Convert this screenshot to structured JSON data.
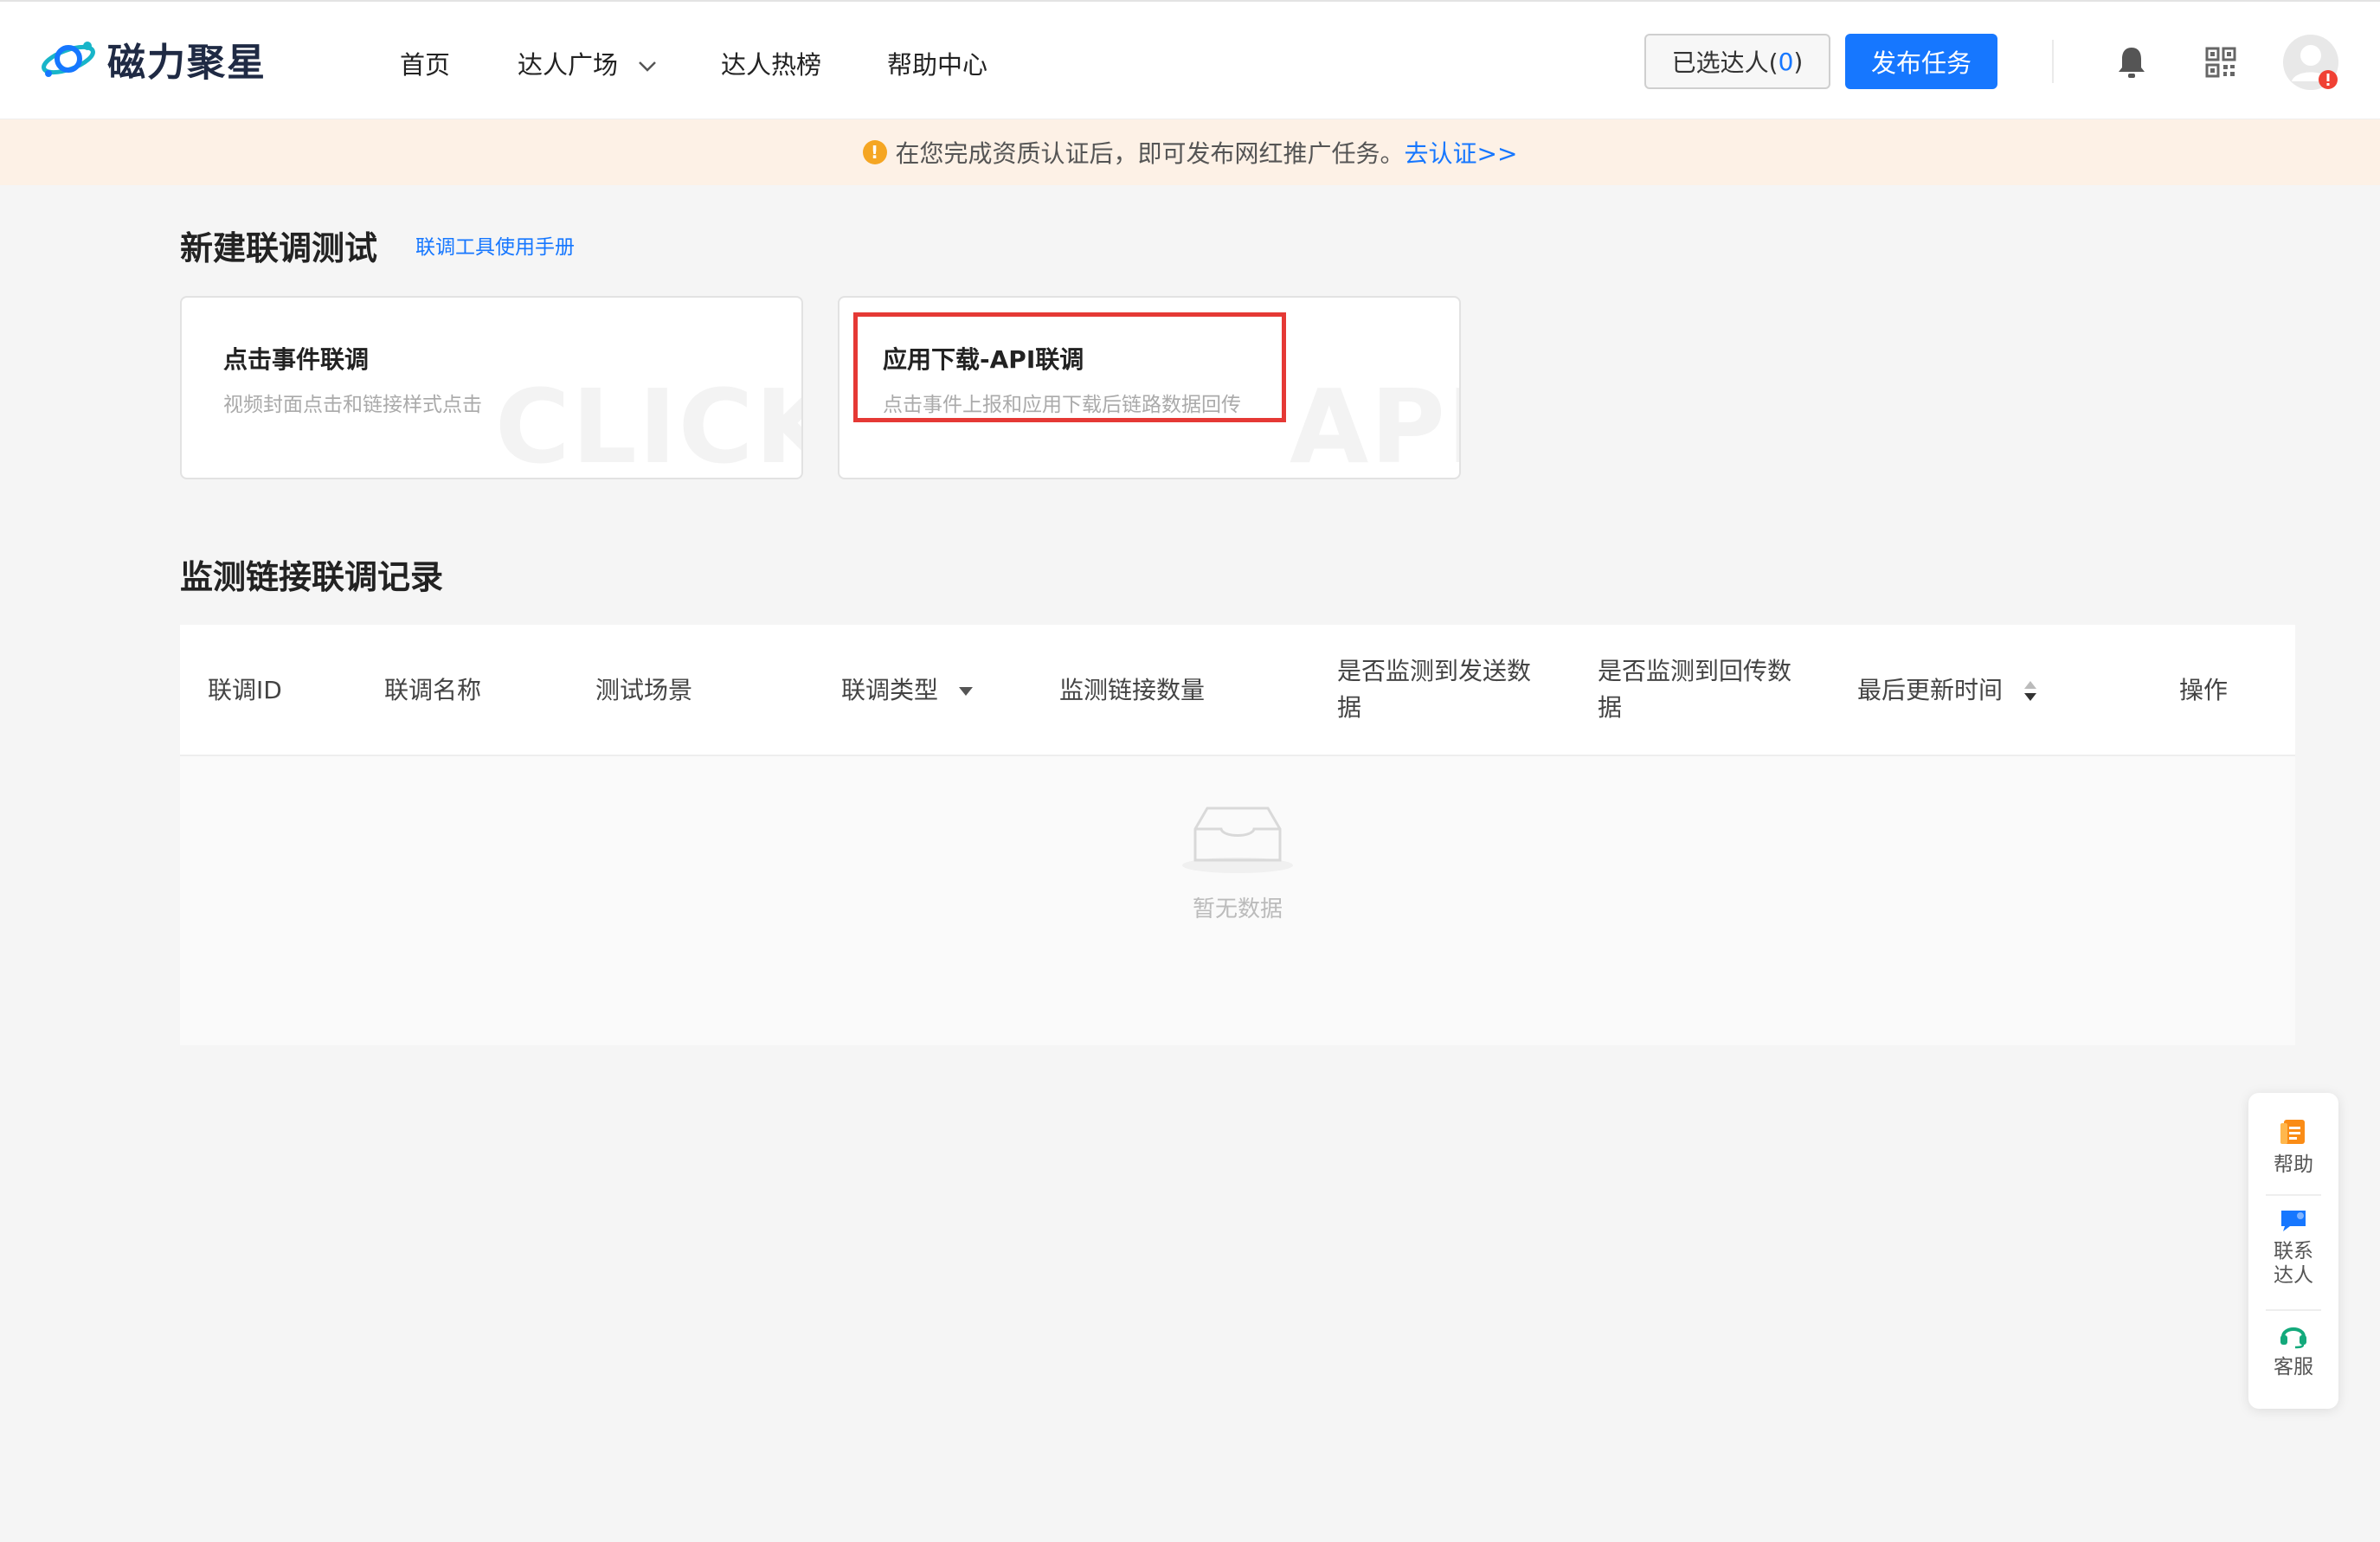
{
  "header": {
    "logo_text": "磁力聚星",
    "nav": [
      {
        "label": "首页"
      },
      {
        "label": "达人广场"
      },
      {
        "label": "达人热榜"
      },
      {
        "label": "帮助中心"
      }
    ],
    "selected_label": "已选达人(",
    "selected_count": "0",
    "selected_close": ")",
    "publish_label": "发布任务",
    "icons": [
      "bell-icon",
      "qrcode-icon",
      "avatar"
    ]
  },
  "banner": {
    "text": "在您完成资质认证后，即可发布网红推广任务。",
    "link": "去认证>>"
  },
  "new_test": {
    "title": "新建联调测试",
    "manual_link": "联调工具使用手册",
    "cards": [
      {
        "title": "点击事件联调",
        "desc": "视频封面点击和链接样式点击",
        "watermark": "CLICK"
      },
      {
        "title": "应用下载-API联调",
        "desc": "点击事件上报和应用下载后链路数据回传",
        "watermark": "API"
      }
    ]
  },
  "records": {
    "title": "监测链接联调记录",
    "columns": [
      {
        "line1": "联调ID",
        "line2": ""
      },
      {
        "line1": "联调名称",
        "line2": ""
      },
      {
        "line1": "测试场景",
        "line2": ""
      },
      {
        "line1": "联调类型",
        "line2": ""
      },
      {
        "line1": "监测链接数量",
        "line2": ""
      },
      {
        "line1": "是否监测到发送数",
        "line2": "据"
      },
      {
        "line1": "是否监测到回传数",
        "line2": "据"
      },
      {
        "line1": "最后更新时间",
        "line2": ""
      },
      {
        "line1": "操作",
        "line2": ""
      }
    ],
    "empty_text": "暂无数据"
  },
  "side_panel": {
    "help": "帮助",
    "contact_line1": "联系",
    "contact_line2": "达人",
    "service": "客服"
  },
  "colors": {
    "primary": "#1677ff",
    "banner_bg": "#fdf1e6",
    "warning": "#f5a623",
    "highlight": "#e53935"
  }
}
